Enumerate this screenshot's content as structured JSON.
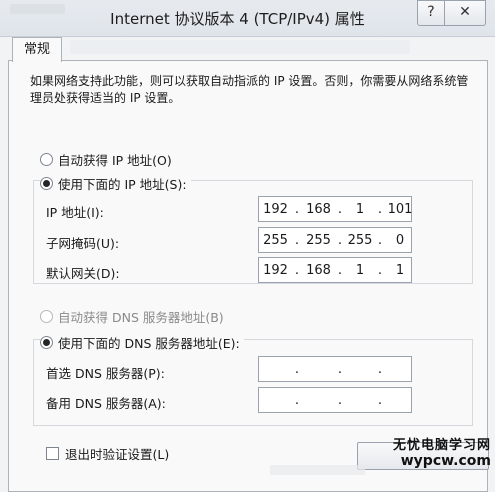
{
  "window": {
    "title": "Internet 协议版本 4 (TCP/IPv4) 属性",
    "help_label": "?",
    "close_label": "✕"
  },
  "tab": {
    "label": "常规"
  },
  "description": "如果网络支持此功能，则可以获取自动指派的 IP 设置。否则，你需要从网络系统管理员处获得适当的 IP 设置。",
  "ip_mode": {
    "auto_label": "自动获得 IP 地址(O)",
    "manual_label": "使用下面的 IP 地址(S):",
    "selected": "manual"
  },
  "ip_fields": [
    {
      "label": "IP 地址(I):",
      "octets": [
        "192",
        "168",
        "1",
        "101"
      ]
    },
    {
      "label": "子网掩码(U):",
      "octets": [
        "255",
        "255",
        "255",
        "0"
      ]
    },
    {
      "label": "默认网关(D):",
      "octets": [
        "192",
        "168",
        "1",
        "1"
      ]
    }
  ],
  "dns_mode": {
    "auto_label": "自动获得 DNS 服务器地址(B)",
    "manual_label": "使用下面的 DNS 服务器地址(E):",
    "selected": "manual"
  },
  "dns_fields": [
    {
      "label": "首选 DNS 服务器(P):",
      "octets": [
        "",
        "",
        "",
        ""
      ]
    },
    {
      "label": "备用 DNS 服务器(A):",
      "octets": [
        "",
        "",
        "",
        ""
      ]
    }
  ],
  "validate": {
    "label": "退出时验证设置(L)",
    "checked": false
  },
  "watermark": {
    "line1": "无忧电脑学习网",
    "line2": "wypcw.com"
  },
  "colors": {
    "titlebar": "#e3e7ec",
    "panel": "#f9f9f9",
    "border": "#aeb3b9"
  }
}
